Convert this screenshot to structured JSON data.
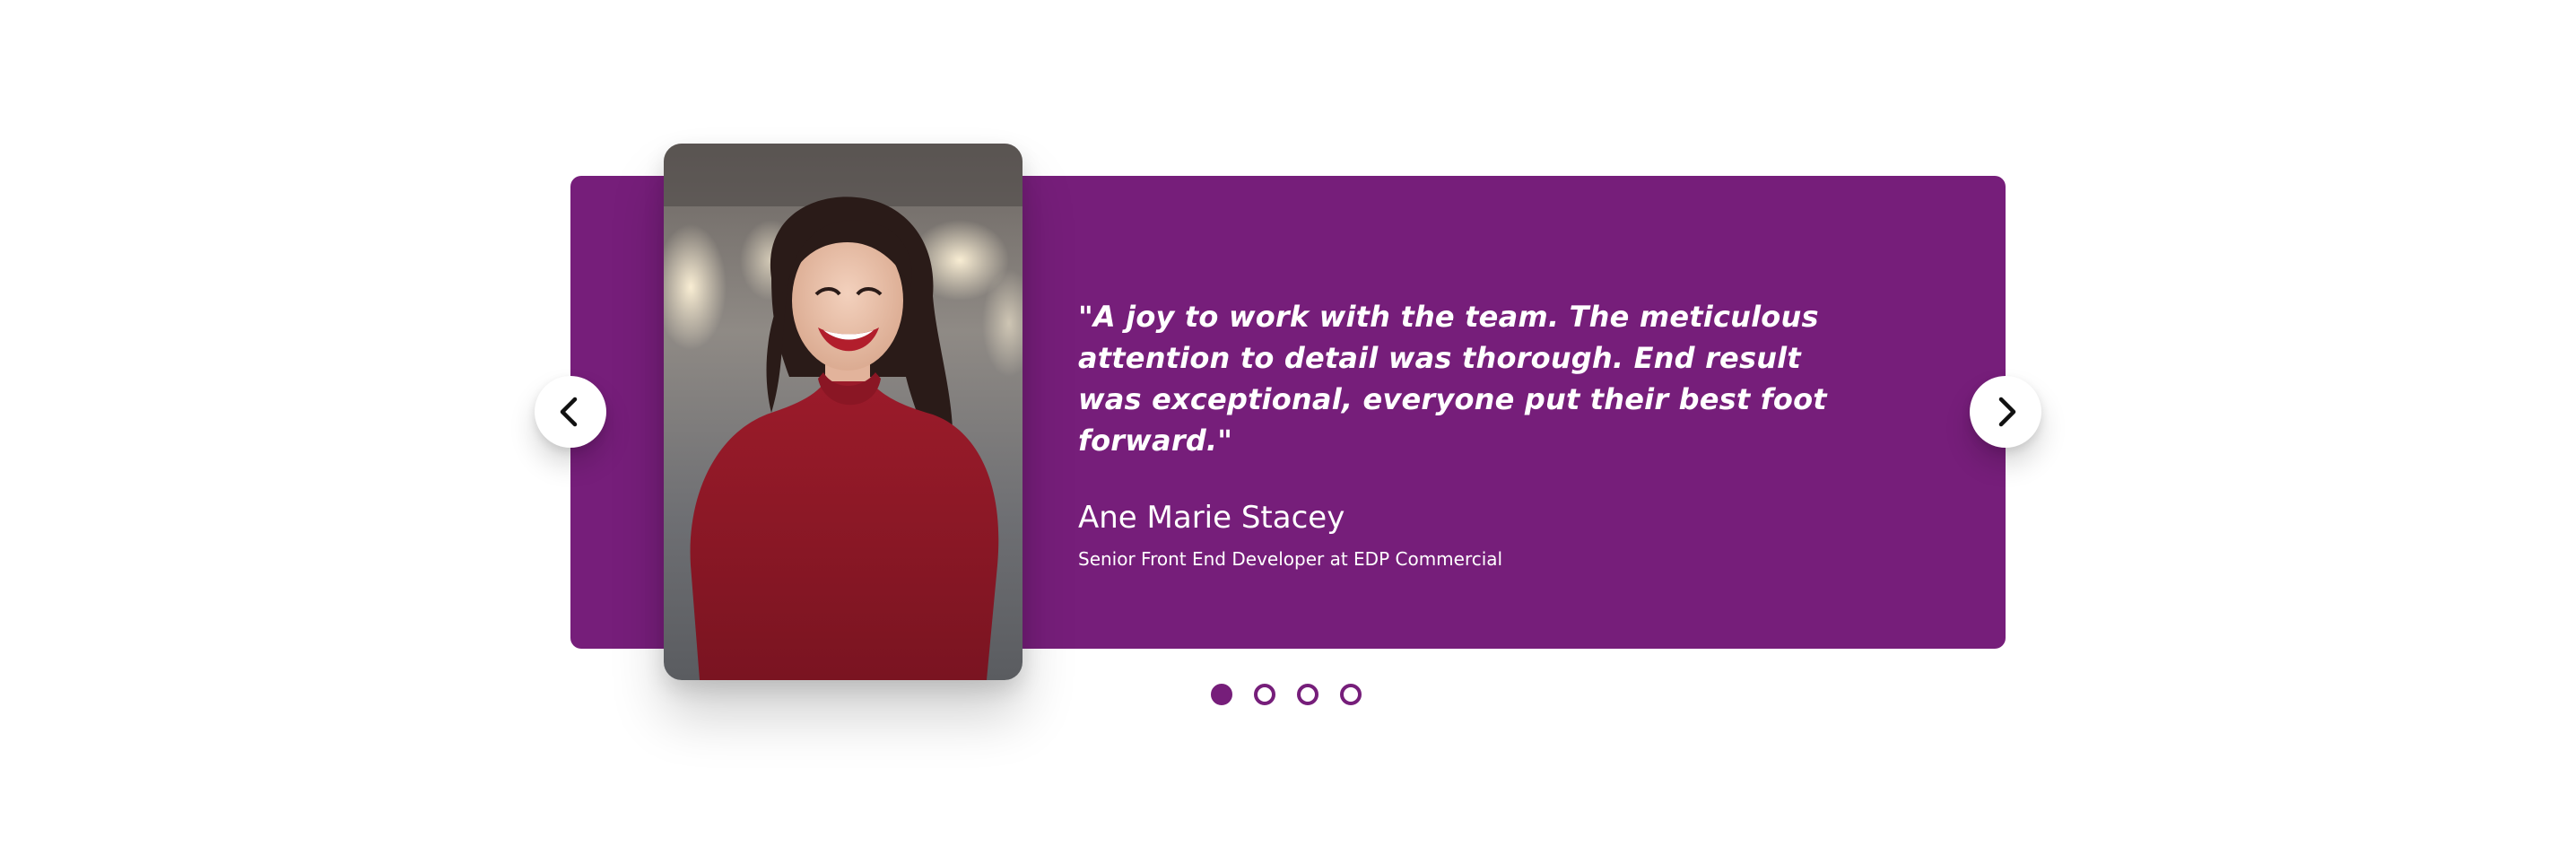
{
  "theme": {
    "accent": "#761e7a",
    "text_on_accent": "#ffffff",
    "nav_button_bg": "#ffffff"
  },
  "testimonial": {
    "quote": "\"A joy to work with the team. The meticulous attention to detail was thorough. End result was exceptional, everyone put their best foot forward.\"",
    "name": "Ane Marie Stacey",
    "role": "Senior Front End Developer at EDP Commercial"
  },
  "navigation": {
    "prev_icon": "chevron-left-icon",
    "next_icon": "chevron-right-icon"
  },
  "pagination": {
    "total": 4,
    "active_index": 0
  }
}
